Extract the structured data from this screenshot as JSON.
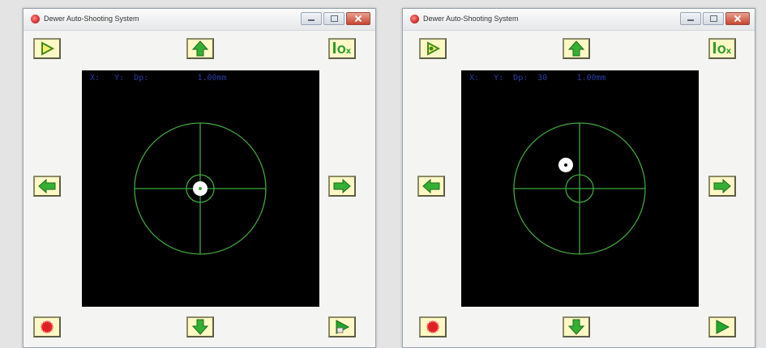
{
  "windows": [
    {
      "title": "Dewer Auto-Shooting System",
      "readout": "X:   Y:  Dp:          1.00mm",
      "impact": {
        "x": 0,
        "y": 0
      },
      "colors": {
        "reticle": "#3fa63f",
        "impact": "#ffffff",
        "screen": "#000000"
      }
    },
    {
      "title": "Dewer Auto-Shooting System",
      "readout": "X:   Y:  Dp:  30      1.00mm",
      "impact": {
        "x": -0.21,
        "y": -0.36
      },
      "colors": {
        "reticle": "#3fa63f",
        "impact": "#ffffff",
        "screen": "#000000"
      }
    }
  ],
  "zoom_label": "10",
  "zoom_suffix": "x",
  "icons": [
    "app-icon",
    "play-icon",
    "arrow-up-icon",
    "zoom-icon",
    "arrow-left-icon",
    "arrow-right-icon",
    "record-icon",
    "arrow-down-icon"
  ]
}
